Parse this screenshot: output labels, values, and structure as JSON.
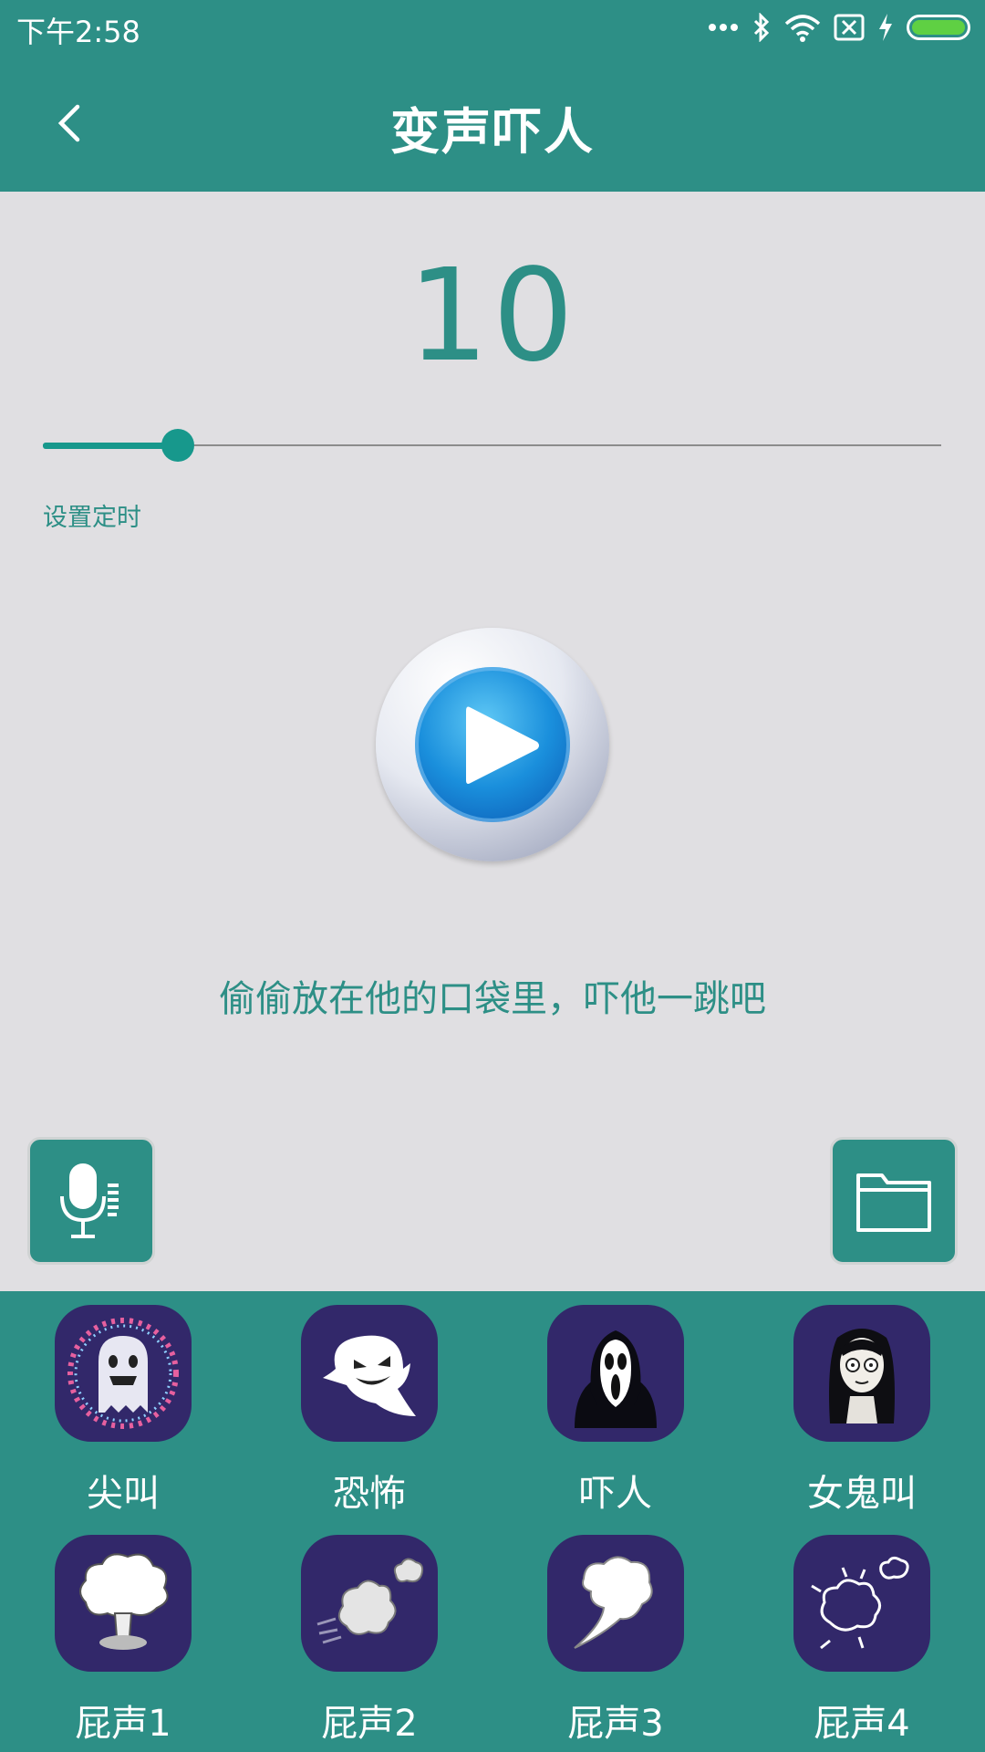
{
  "status_bar": {
    "time": "下午2:58",
    "battery_level": 1.0,
    "icons": [
      "more-dots-icon",
      "bluetooth-icon",
      "wifi-icon",
      "sim-off-icon",
      "charging-icon",
      "battery-icon"
    ]
  },
  "app_bar": {
    "title": "变声吓人",
    "back_icon": "back-arrow-icon"
  },
  "timer": {
    "value": "10",
    "slider_fraction": 0.15,
    "label": "设置定时"
  },
  "play_button": {
    "icon": "play-icon"
  },
  "hint": "偷偷放在他的口袋里，吓他一跳吧",
  "side_buttons": {
    "record_icon": "microphone-icon",
    "folder_icon": "folder-icon"
  },
  "sounds": [
    {
      "label": "尖叫",
      "icon": "screaming-ghost-icon"
    },
    {
      "label": "恐怖",
      "icon": "ghost-icon"
    },
    {
      "label": "吓人",
      "icon": "scream-mask-icon"
    },
    {
      "label": "女鬼叫",
      "icon": "female-ghost-icon"
    },
    {
      "label": "屁声1",
      "icon": "mushroom-cloud-icon"
    },
    {
      "label": "屁声2",
      "icon": "puff-cloud-icon"
    },
    {
      "label": "屁声3",
      "icon": "gust-cloud-icon"
    },
    {
      "label": "屁声4",
      "icon": "burst-cloud-icon"
    }
  ],
  "colors": {
    "primary": "#2d8f86",
    "accent": "#17988c",
    "background": "#e0dfe2",
    "tile": "#32286a"
  }
}
